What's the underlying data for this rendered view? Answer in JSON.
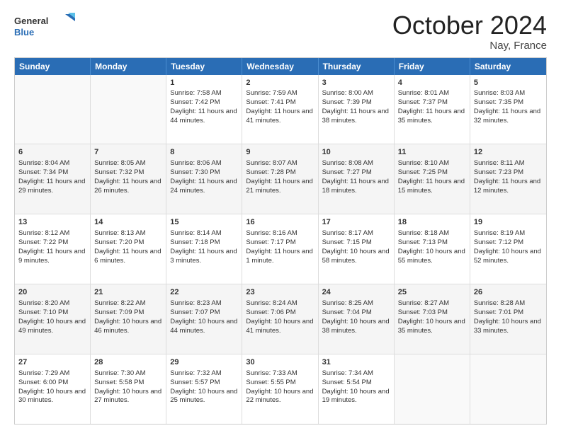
{
  "header": {
    "logo_general": "General",
    "logo_blue": "Blue",
    "month": "October 2024",
    "location": "Nay, France"
  },
  "weekdays": [
    "Sunday",
    "Monday",
    "Tuesday",
    "Wednesday",
    "Thursday",
    "Friday",
    "Saturday"
  ],
  "rows": [
    [
      {
        "day": "",
        "sunrise": "",
        "sunset": "",
        "daylight": ""
      },
      {
        "day": "",
        "sunrise": "",
        "sunset": "",
        "daylight": ""
      },
      {
        "day": "1",
        "sunrise": "Sunrise: 7:58 AM",
        "sunset": "Sunset: 7:42 PM",
        "daylight": "Daylight: 11 hours and 44 minutes."
      },
      {
        "day": "2",
        "sunrise": "Sunrise: 7:59 AM",
        "sunset": "Sunset: 7:41 PM",
        "daylight": "Daylight: 11 hours and 41 minutes."
      },
      {
        "day": "3",
        "sunrise": "Sunrise: 8:00 AM",
        "sunset": "Sunset: 7:39 PM",
        "daylight": "Daylight: 11 hours and 38 minutes."
      },
      {
        "day": "4",
        "sunrise": "Sunrise: 8:01 AM",
        "sunset": "Sunset: 7:37 PM",
        "daylight": "Daylight: 11 hours and 35 minutes."
      },
      {
        "day": "5",
        "sunrise": "Sunrise: 8:03 AM",
        "sunset": "Sunset: 7:35 PM",
        "daylight": "Daylight: 11 hours and 32 minutes."
      }
    ],
    [
      {
        "day": "6",
        "sunrise": "Sunrise: 8:04 AM",
        "sunset": "Sunset: 7:34 PM",
        "daylight": "Daylight: 11 hours and 29 minutes."
      },
      {
        "day": "7",
        "sunrise": "Sunrise: 8:05 AM",
        "sunset": "Sunset: 7:32 PM",
        "daylight": "Daylight: 11 hours and 26 minutes."
      },
      {
        "day": "8",
        "sunrise": "Sunrise: 8:06 AM",
        "sunset": "Sunset: 7:30 PM",
        "daylight": "Daylight: 11 hours and 24 minutes."
      },
      {
        "day": "9",
        "sunrise": "Sunrise: 8:07 AM",
        "sunset": "Sunset: 7:28 PM",
        "daylight": "Daylight: 11 hours and 21 minutes."
      },
      {
        "day": "10",
        "sunrise": "Sunrise: 8:08 AM",
        "sunset": "Sunset: 7:27 PM",
        "daylight": "Daylight: 11 hours and 18 minutes."
      },
      {
        "day": "11",
        "sunrise": "Sunrise: 8:10 AM",
        "sunset": "Sunset: 7:25 PM",
        "daylight": "Daylight: 11 hours and 15 minutes."
      },
      {
        "day": "12",
        "sunrise": "Sunrise: 8:11 AM",
        "sunset": "Sunset: 7:23 PM",
        "daylight": "Daylight: 11 hours and 12 minutes."
      }
    ],
    [
      {
        "day": "13",
        "sunrise": "Sunrise: 8:12 AM",
        "sunset": "Sunset: 7:22 PM",
        "daylight": "Daylight: 11 hours and 9 minutes."
      },
      {
        "day": "14",
        "sunrise": "Sunrise: 8:13 AM",
        "sunset": "Sunset: 7:20 PM",
        "daylight": "Daylight: 11 hours and 6 minutes."
      },
      {
        "day": "15",
        "sunrise": "Sunrise: 8:14 AM",
        "sunset": "Sunset: 7:18 PM",
        "daylight": "Daylight: 11 hours and 3 minutes."
      },
      {
        "day": "16",
        "sunrise": "Sunrise: 8:16 AM",
        "sunset": "Sunset: 7:17 PM",
        "daylight": "Daylight: 11 hours and 1 minute."
      },
      {
        "day": "17",
        "sunrise": "Sunrise: 8:17 AM",
        "sunset": "Sunset: 7:15 PM",
        "daylight": "Daylight: 10 hours and 58 minutes."
      },
      {
        "day": "18",
        "sunrise": "Sunrise: 8:18 AM",
        "sunset": "Sunset: 7:13 PM",
        "daylight": "Daylight: 10 hours and 55 minutes."
      },
      {
        "day": "19",
        "sunrise": "Sunrise: 8:19 AM",
        "sunset": "Sunset: 7:12 PM",
        "daylight": "Daylight: 10 hours and 52 minutes."
      }
    ],
    [
      {
        "day": "20",
        "sunrise": "Sunrise: 8:20 AM",
        "sunset": "Sunset: 7:10 PM",
        "daylight": "Daylight: 10 hours and 49 minutes."
      },
      {
        "day": "21",
        "sunrise": "Sunrise: 8:22 AM",
        "sunset": "Sunset: 7:09 PM",
        "daylight": "Daylight: 10 hours and 46 minutes."
      },
      {
        "day": "22",
        "sunrise": "Sunrise: 8:23 AM",
        "sunset": "Sunset: 7:07 PM",
        "daylight": "Daylight: 10 hours and 44 minutes."
      },
      {
        "day": "23",
        "sunrise": "Sunrise: 8:24 AM",
        "sunset": "Sunset: 7:06 PM",
        "daylight": "Daylight: 10 hours and 41 minutes."
      },
      {
        "day": "24",
        "sunrise": "Sunrise: 8:25 AM",
        "sunset": "Sunset: 7:04 PM",
        "daylight": "Daylight: 10 hours and 38 minutes."
      },
      {
        "day": "25",
        "sunrise": "Sunrise: 8:27 AM",
        "sunset": "Sunset: 7:03 PM",
        "daylight": "Daylight: 10 hours and 35 minutes."
      },
      {
        "day": "26",
        "sunrise": "Sunrise: 8:28 AM",
        "sunset": "Sunset: 7:01 PM",
        "daylight": "Daylight: 10 hours and 33 minutes."
      }
    ],
    [
      {
        "day": "27",
        "sunrise": "Sunrise: 7:29 AM",
        "sunset": "Sunset: 6:00 PM",
        "daylight": "Daylight: 10 hours and 30 minutes."
      },
      {
        "day": "28",
        "sunrise": "Sunrise: 7:30 AM",
        "sunset": "Sunset: 5:58 PM",
        "daylight": "Daylight: 10 hours and 27 minutes."
      },
      {
        "day": "29",
        "sunrise": "Sunrise: 7:32 AM",
        "sunset": "Sunset: 5:57 PM",
        "daylight": "Daylight: 10 hours and 25 minutes."
      },
      {
        "day": "30",
        "sunrise": "Sunrise: 7:33 AM",
        "sunset": "Sunset: 5:55 PM",
        "daylight": "Daylight: 10 hours and 22 minutes."
      },
      {
        "day": "31",
        "sunrise": "Sunrise: 7:34 AM",
        "sunset": "Sunset: 5:54 PM",
        "daylight": "Daylight: 10 hours and 19 minutes."
      },
      {
        "day": "",
        "sunrise": "",
        "sunset": "",
        "daylight": ""
      },
      {
        "day": "",
        "sunrise": "",
        "sunset": "",
        "daylight": ""
      }
    ]
  ]
}
